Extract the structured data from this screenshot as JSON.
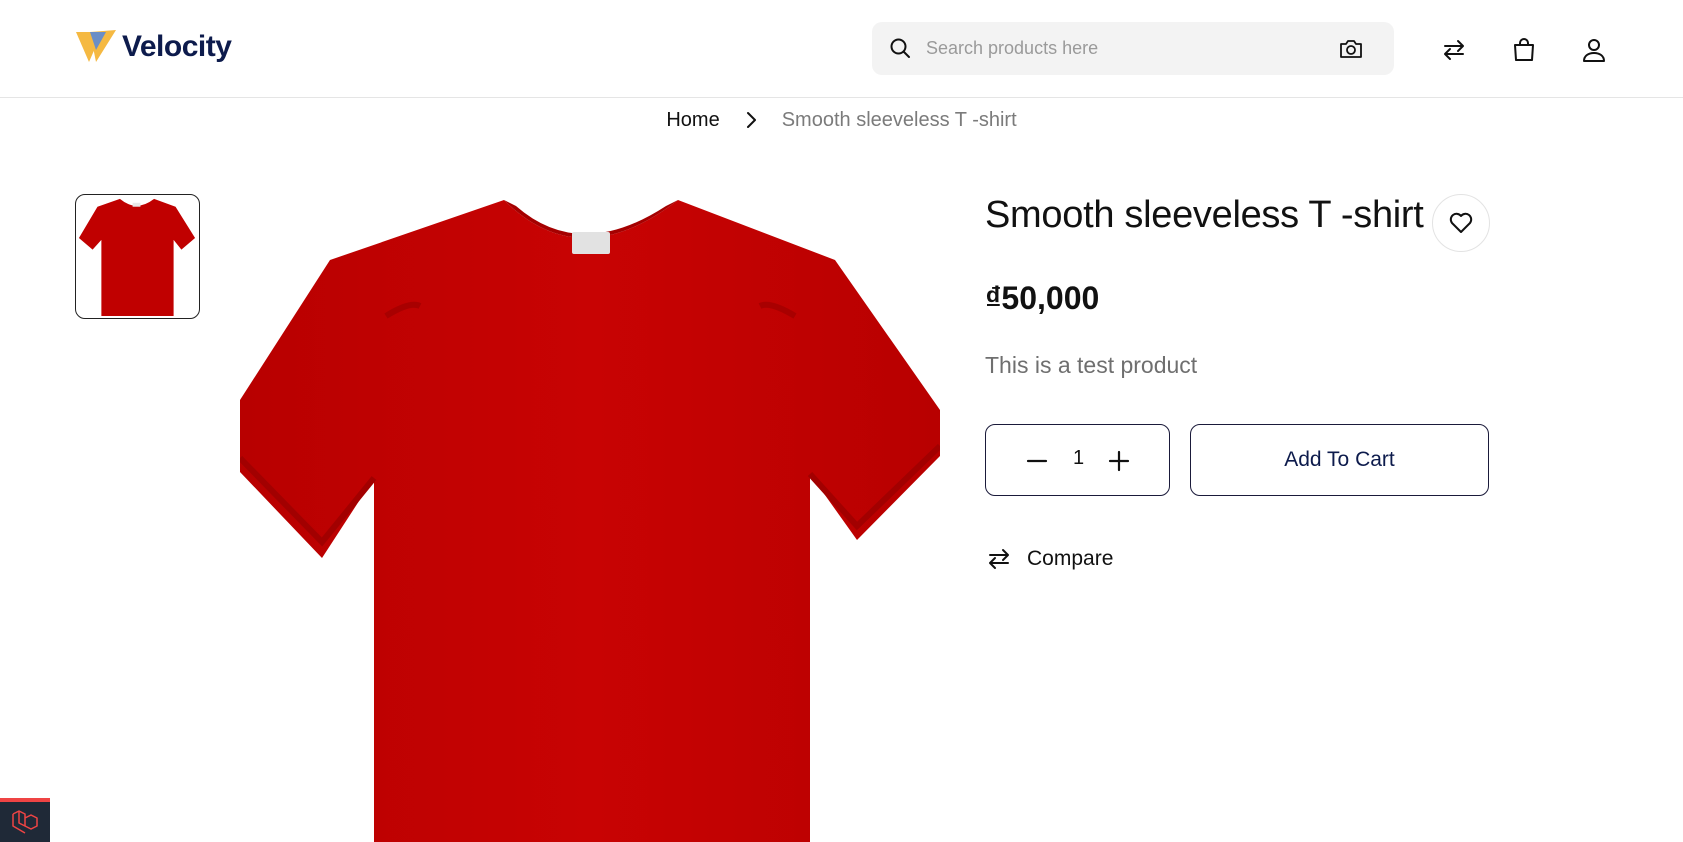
{
  "header": {
    "brand_name": "Velocity",
    "search": {
      "placeholder": "Search products here",
      "value": ""
    },
    "icons": {
      "search": "search-icon",
      "camera": "camera-icon",
      "compare": "compare-arrows-icon",
      "cart": "shopping-bag-icon",
      "account": "user-icon"
    }
  },
  "breadcrumb": {
    "home": "Home",
    "current": "Smooth sleeveless T -shirt"
  },
  "product": {
    "title": "Smooth sleeveless T -shirt",
    "price": "₫50,000",
    "description": "This is a test product",
    "quantity": "1",
    "add_to_cart_label": "Add To Cart",
    "compare_label": "Compare",
    "image_color": "#c00000"
  },
  "colors": {
    "brand_navy": "#0d1b4c",
    "logo_yellow": "#f5b942",
    "logo_blue": "#6b8ec6"
  }
}
